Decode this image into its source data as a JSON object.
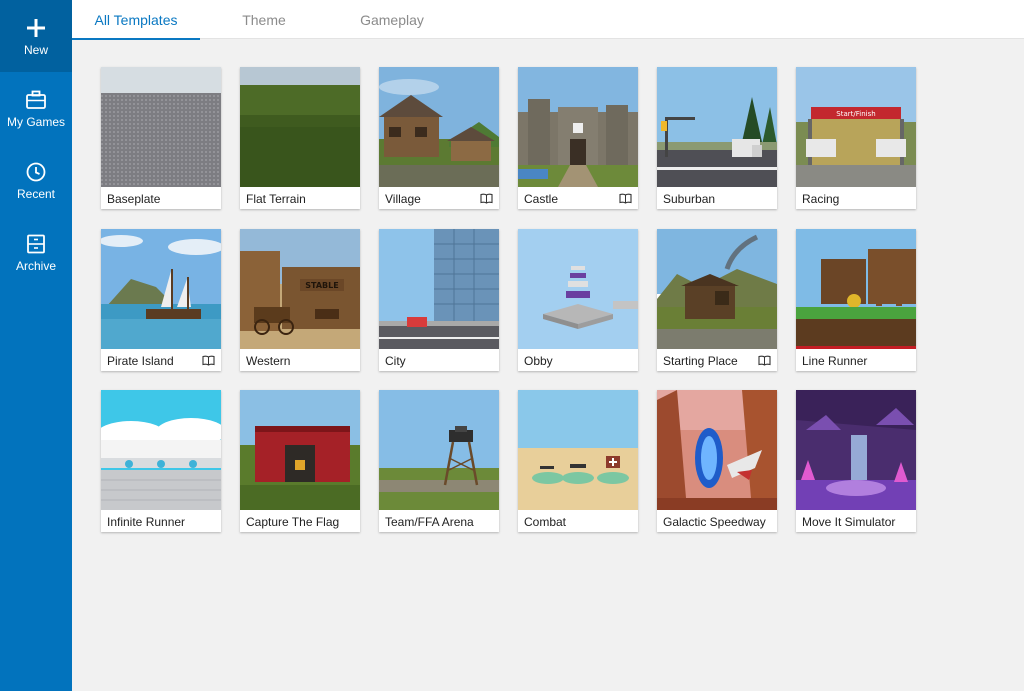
{
  "sidebar": {
    "items": [
      {
        "label": "New",
        "icon": "plus-icon",
        "active": true
      },
      {
        "label": "My Games",
        "icon": "briefcase-icon",
        "active": false
      },
      {
        "label": "Recent",
        "icon": "clock-icon",
        "active": false
      },
      {
        "label": "Archive",
        "icon": "archive-box-icon",
        "active": false
      }
    ]
  },
  "tabs": [
    {
      "label": "All Templates",
      "active": true
    },
    {
      "label": "Theme",
      "active": false
    },
    {
      "label": "Gameplay",
      "active": false
    }
  ],
  "colors": {
    "sidebar": "#0273bd",
    "sidebar_active": "#01619f",
    "accent": "#0a78c2",
    "background": "#f1f1f1"
  },
  "templates": [
    {
      "name": "Baseplate",
      "tutorial": false
    },
    {
      "name": "Flat Terrain",
      "tutorial": false
    },
    {
      "name": "Village",
      "tutorial": true
    },
    {
      "name": "Castle",
      "tutorial": true
    },
    {
      "name": "Suburban",
      "tutorial": false
    },
    {
      "name": "Racing",
      "tutorial": false
    },
    {
      "name": "Pirate Island",
      "tutorial": true
    },
    {
      "name": "Western",
      "tutorial": false
    },
    {
      "name": "City",
      "tutorial": false
    },
    {
      "name": "Obby",
      "tutorial": false
    },
    {
      "name": "Starting Place",
      "tutorial": true
    },
    {
      "name": "Line Runner",
      "tutorial": false
    },
    {
      "name": "Infinite Runner",
      "tutorial": false
    },
    {
      "name": "Capture The Flag",
      "tutorial": false
    },
    {
      "name": "Team/FFA Arena",
      "tutorial": false
    },
    {
      "name": "Combat",
      "tutorial": false
    },
    {
      "name": "Galactic Speedway",
      "tutorial": false
    },
    {
      "name": "Move It Simulator",
      "tutorial": false
    }
  ],
  "thumbnails": {
    "Racing": {
      "banner_text": "Start/Finish"
    },
    "Western": {
      "sign_text": "STABLE"
    }
  }
}
